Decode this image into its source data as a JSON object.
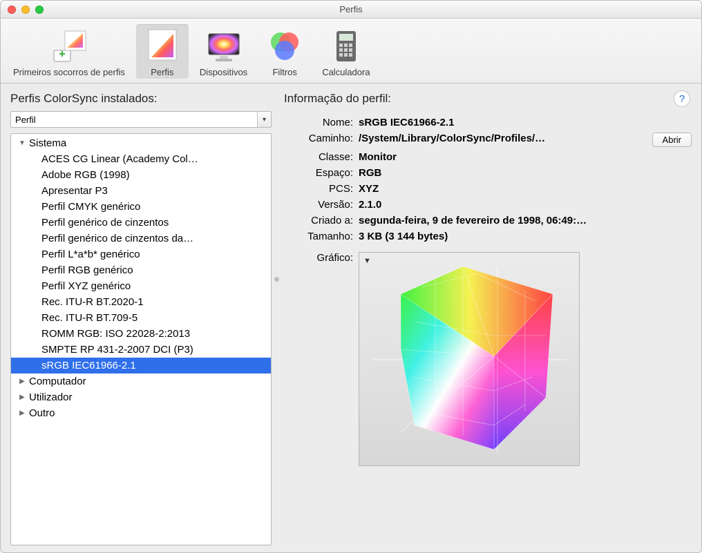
{
  "window": {
    "title": "Perfis"
  },
  "toolbar": {
    "items": [
      {
        "name": "primeiros-socorros",
        "label": "Primeiros socorros de perfis"
      },
      {
        "name": "perfis",
        "label": "Perfis",
        "selected": true
      },
      {
        "name": "dispositivos",
        "label": "Dispositivos"
      },
      {
        "name": "filtros",
        "label": "Filtros"
      },
      {
        "name": "calculadora",
        "label": "Calculadora"
      }
    ]
  },
  "left": {
    "title": "Perfis ColorSync instalados:",
    "dropdown_label": "Perfil",
    "groups": [
      {
        "name": "Sistema",
        "expanded": true,
        "items": [
          "ACES CG Linear (Academy Col…",
          "Adobe RGB (1998)",
          "Apresentar P3",
          "Perfil CMYK genérico",
          "Perfil genérico de cinzentos",
          "Perfil genérico de cinzentos da…",
          "Perfil L*a*b* genérico",
          "Perfil RGB genérico",
          "Perfil XYZ genérico",
          "Rec. ITU-R BT.2020-1",
          "Rec. ITU-R BT.709-5",
          "ROMM RGB: ISO 22028-2:2013",
          "SMPTE RP 431-2-2007 DCI (P3)",
          "sRGB IEC61966-2.1"
        ],
        "selected_index": 13
      },
      {
        "name": "Computador",
        "expanded": false,
        "items": []
      },
      {
        "name": "Utilizador",
        "expanded": false,
        "items": []
      },
      {
        "name": "Outro",
        "expanded": false,
        "items": []
      }
    ]
  },
  "right": {
    "title": "Informação do perfil:",
    "labels": {
      "name": "Nome:",
      "path": "Caminho:",
      "class": "Classe:",
      "space": "Espaço:",
      "pcs": "PCS:",
      "version": "Versão:",
      "created": "Criado a:",
      "size": "Tamanho:",
      "graph": "Gráfico:"
    },
    "values": {
      "name": "sRGB IEC61966-2.1",
      "path": "/System/Library/ColorSync/Profiles/…",
      "class": "Monitor",
      "space": "RGB",
      "pcs": "XYZ",
      "version": "2.1.0",
      "created": "segunda-feira, 9 de fevereiro de 1998, 06:49:…",
      "size": "3 KB (3 144 bytes)"
    },
    "open_button": "Abrir"
  }
}
